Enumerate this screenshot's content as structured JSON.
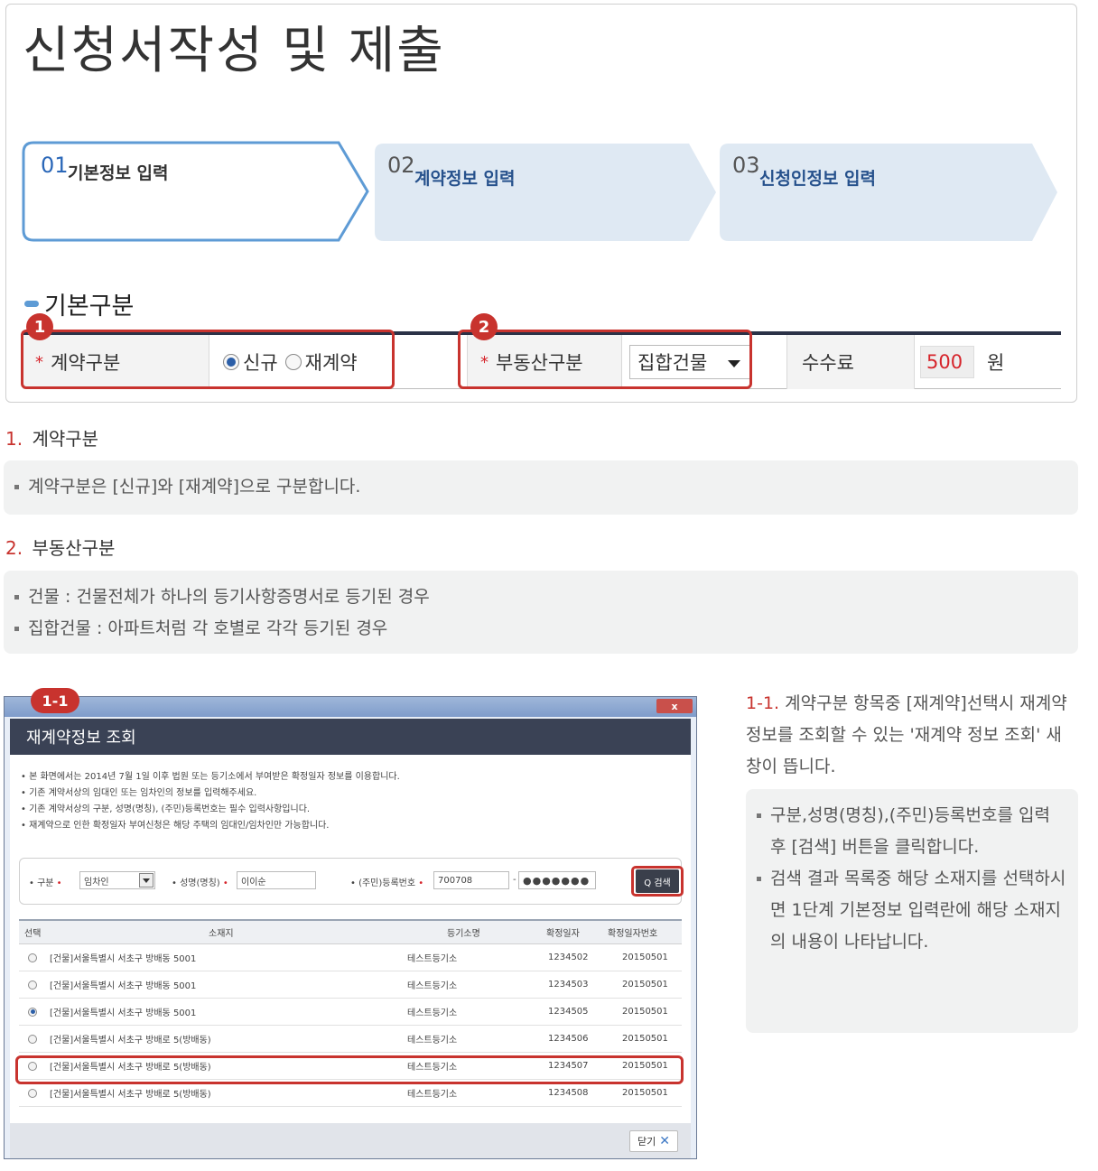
{
  "page_title": "신청서작성 및 제출",
  "steps": [
    {
      "num": "01",
      "label": "기본정보 입력",
      "active": true
    },
    {
      "num": "02",
      "label": "계약정보 입력",
      "active": false
    },
    {
      "num": "03",
      "label": "신청인정보 입력",
      "active": false
    }
  ],
  "section_title": "기본구분",
  "form": {
    "contract_label": "계약구분",
    "radio_new": "신규",
    "radio_renew": "재계약",
    "property_label": "부동산구분",
    "property_value": "집합건물",
    "fee_label": "수수료",
    "fee_value": "500",
    "fee_unit": "원",
    "required_mark": "*"
  },
  "badges": {
    "b1": "1",
    "b2": "2",
    "b11": "1-1"
  },
  "desc1": {
    "num": "1.",
    "title": "계약구분",
    "items": [
      "계약구분은 [신규]와 [재계약]으로 구분합니다."
    ]
  },
  "desc2": {
    "num": "2.",
    "title": "부동산구분",
    "items": [
      "건물 : 건물전체가 하나의 등기사항증명서로 등기된 경우",
      "집합건물 : 아파트처럼 각 호별로 각각 등기된 경우"
    ]
  },
  "popup": {
    "titlebar_close": "x",
    "title": "재계약정보 조회",
    "notes": [
      "• 본 화면에서는 2014년 7월 1일 이후 법원 또는 등기소에서 부여받은 확정일자 정보를 이용합니다.",
      "• 기존 계약서상의 임대인 또는 임차인의 정보를 입력해주세요.",
      "• 기존 계약서상의 구분, 성명(명칭), (주민)등록번호는 필수 입력사항입니다.",
      "• 재계약으로 인한 확정일자 부여신청은 해당 주택의 임대인/임차인만 가능합니다."
    ],
    "search": {
      "type_label": "• 구분",
      "type_value": "임차인",
      "name_label": "• 성명(명칭)",
      "name_value": "이이순",
      "id_label": "• (주민)등록번호",
      "id_front": "700708",
      "id_dash": "-",
      "id_back": "●●●●●●●",
      "req": "•",
      "button": "Q 검색"
    },
    "table": {
      "headers": [
        "선택",
        "소재지",
        "등기소명",
        "확정일자",
        "확정일자번호"
      ],
      "rows": [
        {
          "address": "[건물]서울특별시 서초구 방배동 5001",
          "office": "테스트등기소",
          "date_no": "1234502",
          "fixed": "20150501",
          "selected": false
        },
        {
          "address": "[건물]서울특별시 서초구 방배동 5001",
          "office": "테스트등기소",
          "date_no": "1234503",
          "fixed": "20150501",
          "selected": false
        },
        {
          "address": "[건물]서울특별시 서초구 방배동 5001",
          "office": "테스트등기소",
          "date_no": "1234505",
          "fixed": "20150501",
          "selected": true
        },
        {
          "address": "[건물]서울특별시 서초구 방배로 5(방배동)",
          "office": "테스트등기소",
          "date_no": "1234506",
          "fixed": "20150501",
          "selected": false
        },
        {
          "address": "[건물]서울특별시 서초구 방배로 5(방배동)",
          "office": "테스트등기소",
          "date_no": "1234507",
          "fixed": "20150501",
          "selected": false
        },
        {
          "address": "[건물]서울특별시 서초구 방배로 5(방배동)",
          "office": "테스트등기소",
          "date_no": "1234508",
          "fixed": "20150501",
          "selected": false
        }
      ]
    },
    "close_label": "닫기",
    "close_x": "✕"
  },
  "side": {
    "num": "1-1.",
    "title": "계약구분 항목중 [재계약]선택시 재계약 정보를 조회할 수 있는 '재계약 정보 조회' 새창이 뜹니다.",
    "items": [
      "구분,성명(명칭),(주민)등록번호를 입력 후 [검색] 버튼을 클릭합니다.",
      "검색 결과 목록중 해당 소재지를 선택하시면 1단계 기본정보 입력란에 해당 소재지의 내용이 나타납니다."
    ]
  },
  "colors": {
    "accent_red": "#c8332e",
    "step_blue": "#5e9bd5",
    "step_inactive": "#dfe9f3"
  }
}
